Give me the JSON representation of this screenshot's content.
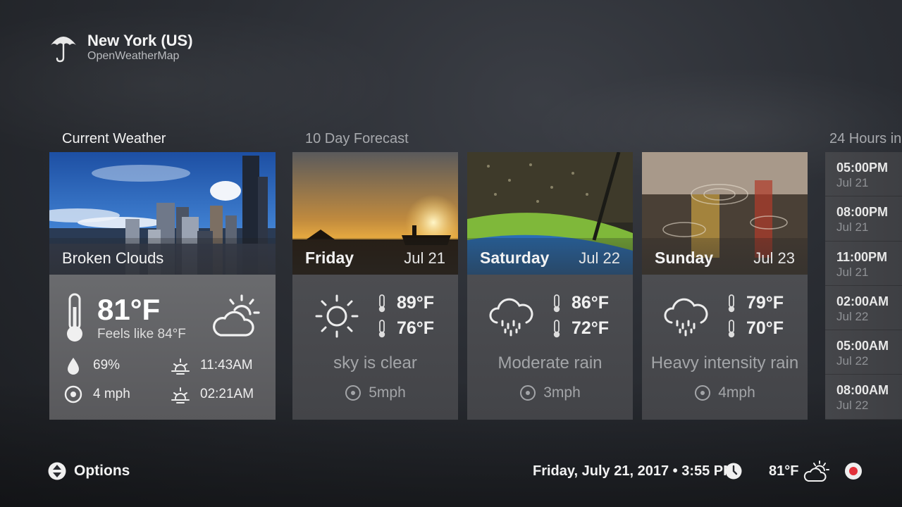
{
  "header": {
    "location": "New York (US)",
    "provider": "OpenWeatherMap"
  },
  "sections": {
    "current": "Current Weather",
    "forecast": "10 Day Forecast",
    "hours": "24 Hours in"
  },
  "current": {
    "condition": "Broken Clouds",
    "temp": "81°F",
    "feels_like": "Feels like 84°F",
    "humidity": "69%",
    "wind": "4 mph",
    "sunrise": "11:43AM",
    "sunset": "02:21AM",
    "icon": "cloud-sun-icon"
  },
  "forecast": [
    {
      "day": "Friday",
      "date": "Jul 21",
      "high": "89°F",
      "low": "76°F",
      "desc": "sky is clear",
      "wind": "5mph",
      "icon": "sun-icon"
    },
    {
      "day": "Saturday",
      "date": "Jul 22",
      "high": "86°F",
      "low": "72°F",
      "desc": "Moderate rain",
      "wind": "3mph",
      "icon": "rain-cloud-icon"
    },
    {
      "day": "Sunday",
      "date": "Jul 23",
      "high": "79°F",
      "low": "70°F",
      "desc": "Heavy intensity rain",
      "wind": "4mph",
      "icon": "rain-cloud-icon"
    }
  ],
  "hours": [
    {
      "time": "05:00PM",
      "date": "Jul 21"
    },
    {
      "time": "08:00PM",
      "date": "Jul 21"
    },
    {
      "time": "11:00PM",
      "date": "Jul 21"
    },
    {
      "time": "02:00AM",
      "date": "Jul 22"
    },
    {
      "time": "05:00AM",
      "date": "Jul 22"
    },
    {
      "time": "08:00AM",
      "date": "Jul 22"
    }
  ],
  "footer": {
    "options_label": "Options",
    "datetime": "Friday, July 21, 2017 • 3:55 PM",
    "temp": "81°F"
  },
  "colors": {
    "accent_record": "#e2313a",
    "card_current": "#6a6b6e",
    "card_forecast": "#4c4d51"
  }
}
